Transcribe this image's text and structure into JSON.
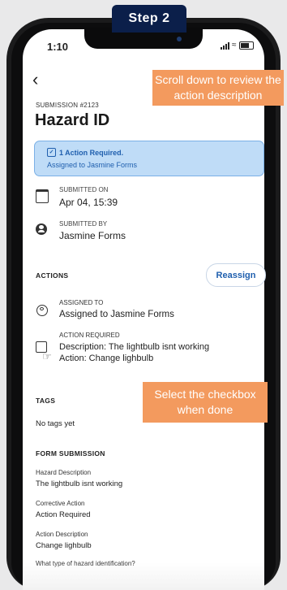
{
  "banner": {
    "step": "Step 2"
  },
  "status_bar": {
    "time": "1:10"
  },
  "tooltips": {
    "scroll": "Scroll down to review the action description",
    "checkbox": "Select the checkbox when done"
  },
  "submission": {
    "id_label": "SUBMISSION #2123",
    "title": "Hazard ID",
    "alert_title": "1 Action Required.",
    "alert_sub": "Assigned to Jasmine Forms",
    "submitted_on_label": "SUBMITTED ON",
    "submitted_on": "Apr 04, 15:39",
    "submitted_by_label": "SUBMITTED BY",
    "submitted_by": "Jasmine Forms"
  },
  "actions": {
    "header": "ACTIONS",
    "reassign": "Reassign",
    "assigned_label": "ASSIGNED TO",
    "assigned_value": "Assigned to Jasmine Forms",
    "required_label": "ACTION REQUIRED",
    "description": "Description: The lightbulb isnt working",
    "action": "Action: Change lighbulb"
  },
  "tags": {
    "header": "TAGS",
    "empty": "No tags yet"
  },
  "form": {
    "header": "FORM SUBMISSION",
    "fields": [
      {
        "label": "Hazard Description",
        "value": "The lightbulb isnt working"
      },
      {
        "label": "Corrective Action",
        "value": "Action Required"
      },
      {
        "label": "Action Description",
        "value": "Change lighbulb"
      }
    ],
    "next_question": "What type of hazard identification?"
  }
}
